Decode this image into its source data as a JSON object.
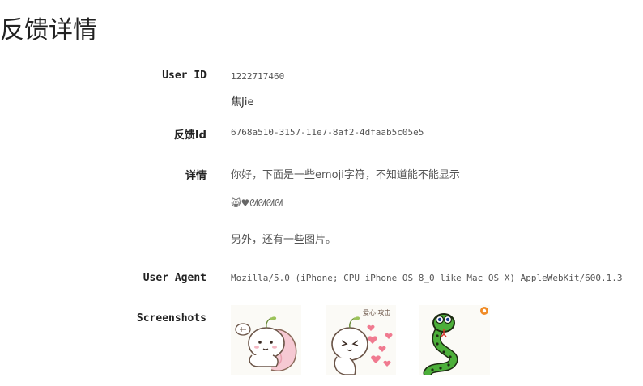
{
  "page": {
    "title": "反馈详情"
  },
  "fields": {
    "user_id": {
      "label": "User ID",
      "value": "1222717460",
      "name": "焦Jie"
    },
    "feedback_id": {
      "label": "反馈Id",
      "value": "6768a510-3157-11e7-8af2-4dfaab5c05e5"
    },
    "detail": {
      "label": "详情",
      "line1": "你好，下面是一些emoji字符，不知道能不能显示",
      "emoji": [
        "😸",
        "♥",
        "ᘛ",
        "ᘛ",
        "ᘛ",
        "ᘛ"
      ],
      "line2": "另外，还有一些图片。"
    },
    "user_agent": {
      "label": "User Agent",
      "value": "Mozilla/5.0 (iPhone; CPU iPhone OS 8_0 like Mac OS X) AppleWebKit/600.1.3"
    },
    "screenshots": {
      "label": "Screenshots",
      "items": [
        {
          "caption": "",
          "kind": "sticker-sitting"
        },
        {
          "caption": "爱心·攻击",
          "kind": "sticker-hearts"
        },
        {
          "caption": "",
          "kind": "sticker-snake"
        }
      ]
    }
  }
}
